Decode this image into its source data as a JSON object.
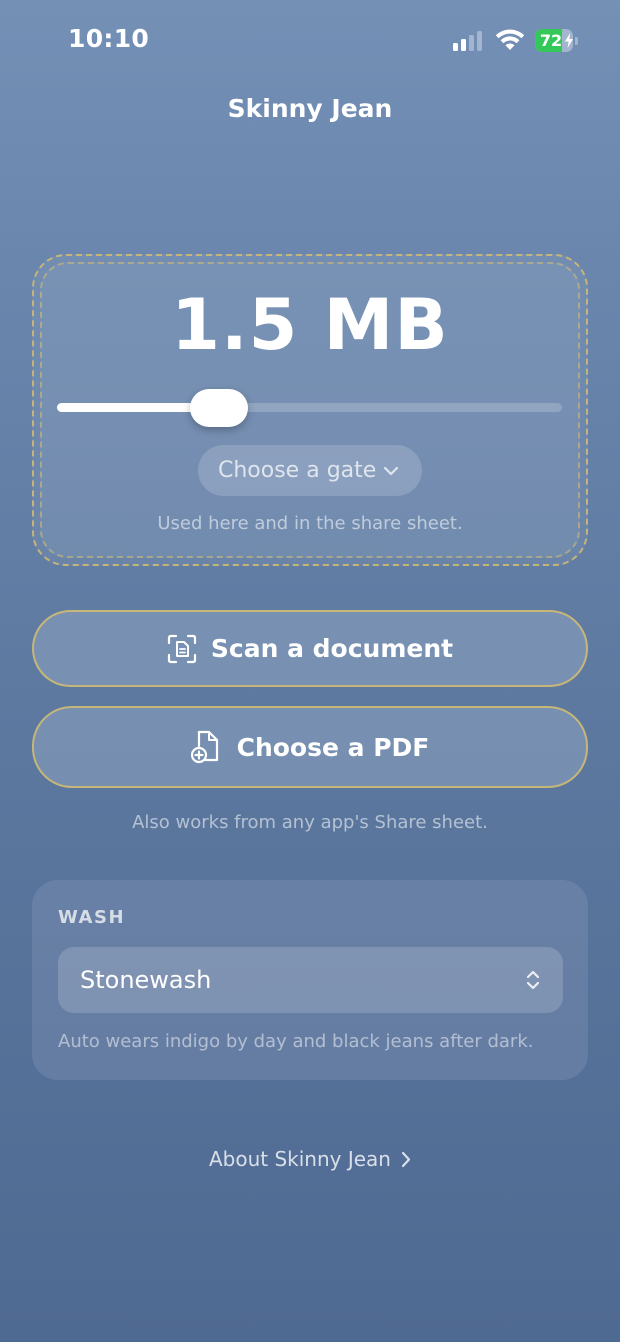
{
  "status_bar": {
    "time": "10:10",
    "battery_level": "72",
    "battery_fraction": 0.72,
    "battery_color": "#34c759",
    "icons": [
      "cellular-signal-icon",
      "wifi-icon",
      "battery-charging-icon"
    ]
  },
  "nav": {
    "title": "Skinny Jean"
  },
  "size_card": {
    "value_label": "1.5 MB",
    "slider_fraction": 0.32,
    "gate_button_label": "Choose a gate",
    "gate_icon": "chevron-down-icon",
    "caption": "Used here and in the share sheet."
  },
  "actions": {
    "scan_label": "Scan a document",
    "scan_icon": "document-scanner-icon",
    "pdf_label": "Choose a PDF",
    "pdf_icon": "document-add-icon",
    "caption": "Also works from any app's Share sheet."
  },
  "wash": {
    "heading": "WASH",
    "selected": "Stonewash",
    "selector_icon": "chevron-up-down-icon",
    "note": "Auto wears indigo by day and black jeans after dark."
  },
  "footer": {
    "about_label": "About Skinny Jean",
    "about_icon": "chevron-right-icon"
  },
  "colors": {
    "accent_border": "#d6bd6e",
    "background_top": "#7490b5",
    "background_bottom": "#4f6a92"
  }
}
